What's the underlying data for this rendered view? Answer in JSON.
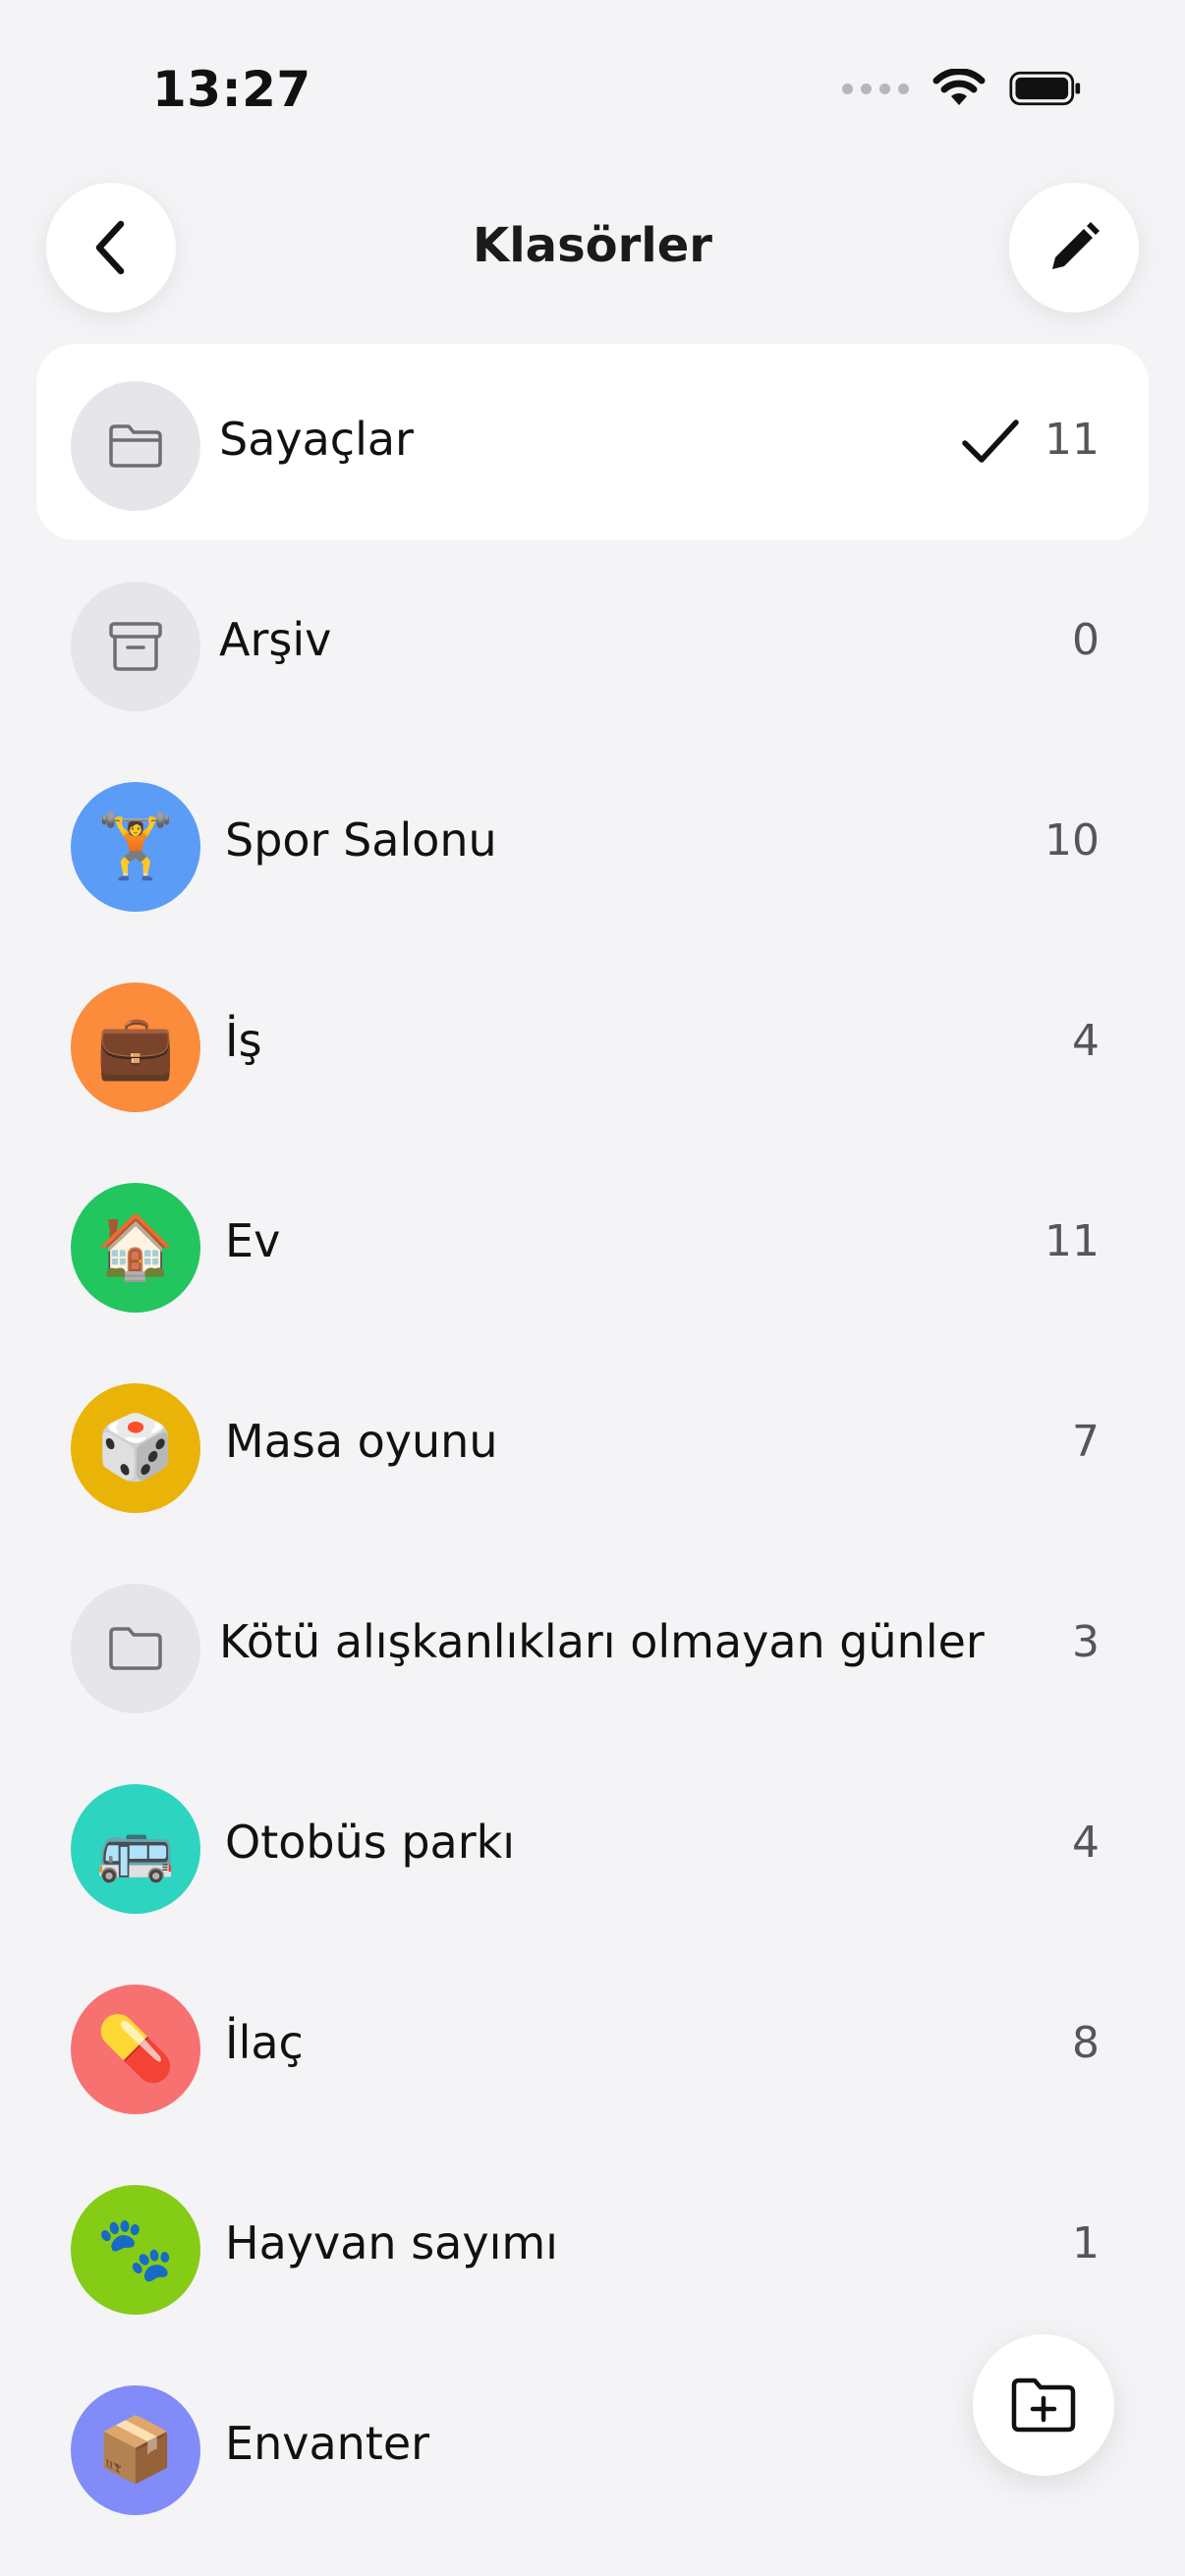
{
  "status_bar": {
    "time": "13:27"
  },
  "header": {
    "title": "Klasörler",
    "back_icon": "chevron-left-icon",
    "edit_icon": "pencil-icon"
  },
  "folders": [
    {
      "name": "Sayaçlar",
      "count": "11",
      "icon": "folder-icon",
      "emoji": "",
      "bg": "#e6e6ea",
      "selected": true
    },
    {
      "name": "Arşiv",
      "count": "0",
      "icon": "archive-box-icon",
      "emoji": "",
      "bg": "#e6e6ea",
      "selected": false
    },
    {
      "name": "Spor Salonu",
      "count": "10",
      "icon": "weightlifter-emoji",
      "emoji": "🏋️",
      "bg": "#5b9cf6",
      "selected": false
    },
    {
      "name": "İş",
      "count": "4",
      "icon": "briefcase-emoji",
      "emoji": "💼",
      "bg": "#fb8c3c",
      "selected": false
    },
    {
      "name": "Ev",
      "count": "11",
      "icon": "house-emoji",
      "emoji": "🏠",
      "bg": "#22c55e",
      "selected": false
    },
    {
      "name": "Masa oyunu",
      "count": "7",
      "icon": "dice-emoji",
      "emoji": "🎲",
      "bg": "#eab308",
      "selected": false
    },
    {
      "name": "Kötü alışkanlıkları olmayan günler",
      "count": "3",
      "icon": "folder-icon",
      "emoji": "",
      "bg": "#e6e6ea",
      "selected": false
    },
    {
      "name": "Otobüs parkı",
      "count": "4",
      "icon": "bus-emoji",
      "emoji": "🚌",
      "bg": "#2dd4bf",
      "selected": false
    },
    {
      "name": "İlaç",
      "count": "8",
      "icon": "pill-emoji",
      "emoji": "💊",
      "bg": "#f87171",
      "selected": false
    },
    {
      "name": "Hayvan sayımı",
      "count": "1",
      "icon": "paw-prints-emoji",
      "emoji": "🐾",
      "bg": "#84cc16",
      "selected": false
    },
    {
      "name": "Envanter",
      "count": "",
      "icon": "package-emoji",
      "emoji": "📦",
      "bg": "#818cf8",
      "selected": false
    }
  ],
  "fab": {
    "icon": "folder-plus-icon"
  }
}
